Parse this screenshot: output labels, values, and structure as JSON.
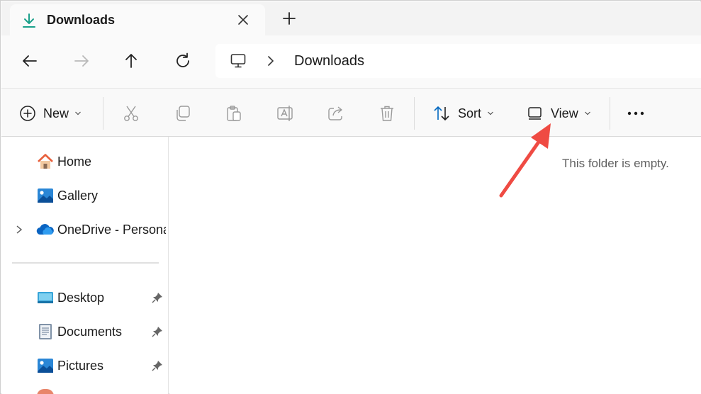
{
  "tab": {
    "title": "Downloads"
  },
  "address": {
    "crumb": "Downloads"
  },
  "commands": {
    "new_label": "New",
    "sort_label": "Sort",
    "view_label": "View"
  },
  "sidebar": {
    "items": [
      {
        "label": "Home"
      },
      {
        "label": "Gallery"
      },
      {
        "label": "OneDrive - Personal"
      },
      {
        "label": "Desktop"
      },
      {
        "label": "Documents"
      },
      {
        "label": "Pictures"
      }
    ]
  },
  "content": {
    "empty_message": "This folder is empty."
  },
  "colors": {
    "accent": "#0067c0",
    "annotation_arrow": "#ef4b43",
    "home_roof": "#e8603c",
    "onedrive": "#0a64c2"
  }
}
